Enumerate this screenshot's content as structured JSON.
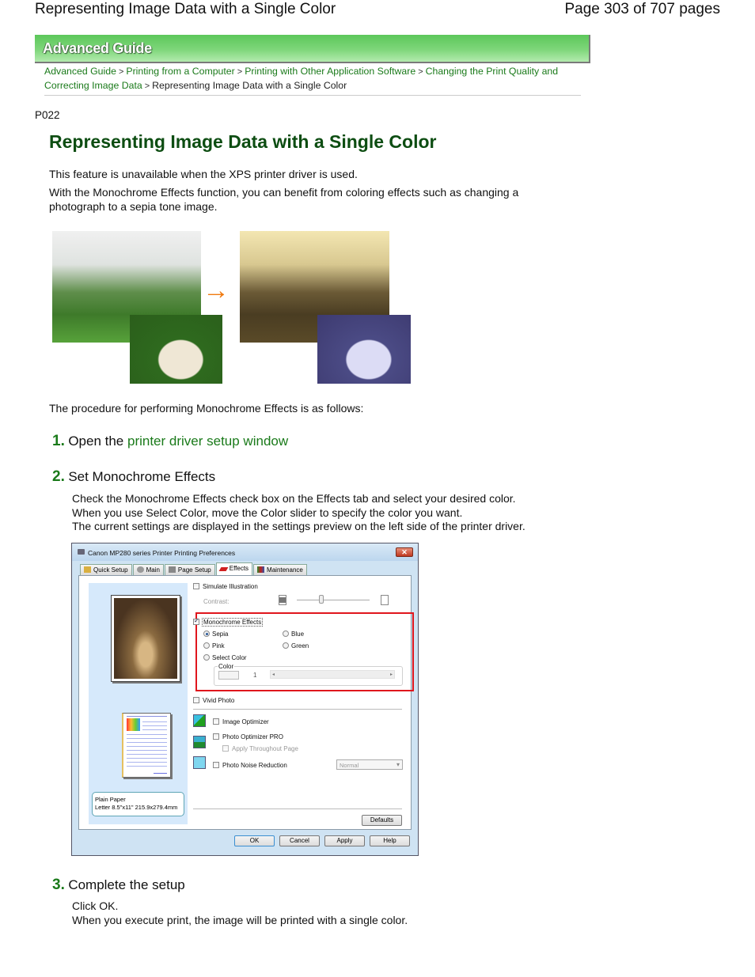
{
  "page_header": {
    "title": "Representing Image Data with a Single Color",
    "page_info": "Page 303 of 707 pages"
  },
  "banner": {
    "label": "Advanced Guide"
  },
  "breadcrumb": {
    "links": [
      "Advanced Guide",
      "Printing from a Computer",
      "Printing with Other Application Software",
      "Changing the Print Quality and Correcting Image Data"
    ],
    "separator": ">",
    "current": "Representing Image Data with a Single Color"
  },
  "doc_code": "P022",
  "heading": "Representing Image Data with a Single Color",
  "intro": [
    "This feature is unavailable when the XPS printer driver is used.",
    "With the Monochrome Effects function, you can benefit from coloring effects such as changing a photograph to a sepia tone image."
  ],
  "illustration": {
    "before_label": "color photos",
    "after_label": "monochrome photos",
    "arrow": "→"
  },
  "procedure_intro": "The procedure for performing Monochrome Effects is as follows:",
  "steps": [
    {
      "number": "1.",
      "title_prefix": "Open the ",
      "link": "printer driver setup window"
    },
    {
      "number": "2.",
      "title": "Set Monochrome Effects",
      "body": [
        "Check the Monochrome Effects check box on the Effects tab and select your desired color.",
        "When you use Select Color, move the Color slider to specify the color you want.",
        "The current settings are displayed in the settings preview on the left side of the printer driver."
      ]
    },
    {
      "number": "3.",
      "title": "Complete the setup",
      "body": [
        "Click OK.",
        "When you execute print, the image will be printed with a single color."
      ]
    }
  ],
  "dialog": {
    "title": "Canon MP280 series Printer Printing Preferences",
    "close": "✕",
    "tabs": [
      "Quick Setup",
      "Main",
      "Page Setup",
      "Effects",
      "Maintenance"
    ],
    "active_tab": "Effects",
    "simulate_illustration": {
      "label": "Simulate Illustration",
      "checked": false
    },
    "contrast_label": "Contrast:",
    "monochrome_effects": {
      "label": "Monochrome Effects",
      "checked": true
    },
    "colors": [
      "Sepia",
      "Pink",
      "Select Color",
      "Blue",
      "Green"
    ],
    "selected_color": "Sepia",
    "color_group_label": "Color",
    "color_value": "1",
    "vivid_photo": {
      "label": "Vivid Photo",
      "checked": false
    },
    "image_optimizer": {
      "label": "Image Optimizer",
      "checked": false
    },
    "photo_optimizer_pro": {
      "label": "Photo Optimizer PRO",
      "checked": false
    },
    "apply_throughout_page": {
      "label": "Apply Throughout Page",
      "checked": false
    },
    "photo_noise_reduction": {
      "label": "Photo Noise Reduction",
      "checked": false
    },
    "noise_level": "Normal",
    "paper_info_line1": "Plain Paper",
    "paper_info_line2": "Letter 8.5\"x11\" 215.9x279.4mm",
    "defaults_button": "Defaults",
    "ok_button": "OK",
    "cancel_button": "Cancel",
    "apply_button": "Apply",
    "help_button": "Help"
  }
}
